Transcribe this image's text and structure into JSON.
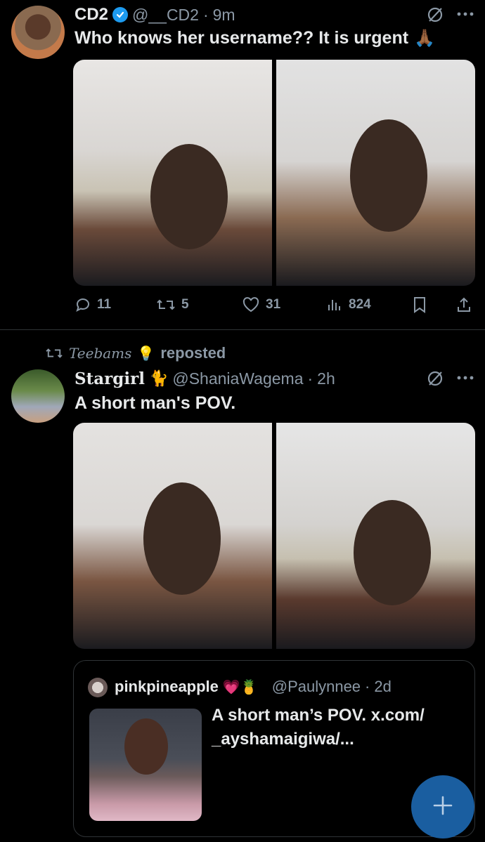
{
  "tweet1": {
    "display_name": "CD2",
    "handle": "@__CD2",
    "separator": "·",
    "time": "9m",
    "text": "Who knows her username?? It is urgent",
    "emoji": "🙏🏾",
    "replies": "11",
    "reposts": "5",
    "likes": "31",
    "views": "824"
  },
  "repost": {
    "reposter": "Teebams",
    "bulb": "💡",
    "label": "reposted"
  },
  "tweet2": {
    "display_name": "Stargirl",
    "name_emoji": "🐈",
    "handle": "@ShaniaWagema",
    "separator": "·",
    "time": "2h",
    "text": "A short man's POV."
  },
  "quoted": {
    "display_name": "pinkpineapple",
    "name_emojis": "💗🍍",
    "handle": "@Paulynnee",
    "separator": "·",
    "time": "2d",
    "text_line1": "A short man’s POV. x.com/",
    "text_line2": "_ayshamaigiwa/..."
  },
  "fab": {
    "icon": "plus-icon"
  },
  "colors": {
    "background": "#000000",
    "text": "#e7e9ea",
    "muted": "#8b98a5",
    "divider": "#2f3336",
    "verified": "#1d9bf0",
    "fab": "#1a5ea0"
  }
}
